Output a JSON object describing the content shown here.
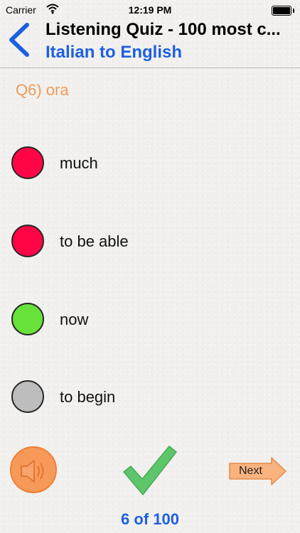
{
  "status_bar": {
    "carrier": "Carrier",
    "time": "12:19 PM"
  },
  "nav": {
    "title": "Listening Quiz - 100 most c...",
    "subtitle": "Italian to English",
    "back_icon": "chevron-left-icon"
  },
  "question": {
    "text": "Q6) ora"
  },
  "options": [
    {
      "label": "much",
      "state": "wrong",
      "color": "#ff0546"
    },
    {
      "label": "to be able",
      "state": "wrong",
      "color": "#ff0546"
    },
    {
      "label": "now",
      "state": "correct",
      "color": "#67e23b"
    },
    {
      "label": "to begin",
      "state": "unanswered",
      "color": "#bdbdbd"
    }
  ],
  "controls": {
    "speaker_icon": "speaker-icon",
    "check_icon": "checkmark-icon",
    "next_label": "Next",
    "progress": "6 of 100"
  },
  "colors": {
    "accent_blue": "#1d60e0",
    "question_orange": "#f09a58",
    "speaker_orange": "#f79a59",
    "check_green": "#5ec66a"
  }
}
